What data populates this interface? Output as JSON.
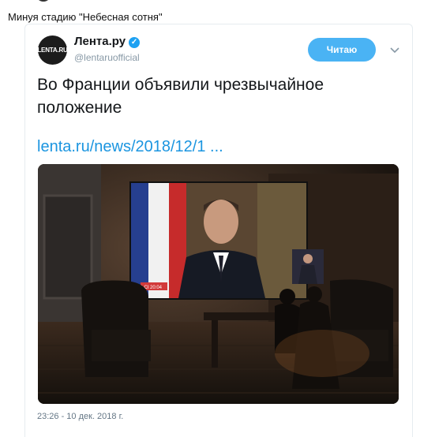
{
  "caption": "Минуя стадию \"Небесная сотня\"",
  "tweet": {
    "avatar_text": "LENTA.RU",
    "display_name": "Лента.ру",
    "handle": "@lentaruofficial",
    "follow_label": "Читаю",
    "text": "Во Франции объявили чрезвычайное положение",
    "link": "lenta.ru/news/2018/12/1  ...",
    "timestamp": "23:26 - 10 дек. 2018 г.",
    "screen_badge": "LCI 20:04"
  },
  "icons": {
    "verified": "verified-badge-icon",
    "chevron": "chevron-down-icon"
  },
  "colors": {
    "accent": "#1da1f2",
    "follow_button": "#4ab3f4",
    "link": "#1b95e0",
    "muted": "#657786"
  }
}
